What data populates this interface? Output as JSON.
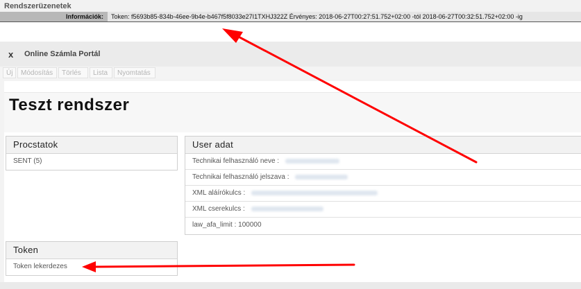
{
  "system_messages": {
    "title": "Rendszerüzenetek",
    "info_label": "Információk:",
    "info_text": "Token: f5693b85-834b-46ee-9b4e-b467f5f8033e27I1TXHJ322Z Érvényes: 2018-06-27T00:27:51.752+02:00 -tól 2018-06-27T00:32:51.752+02:00 -ig"
  },
  "portal": {
    "close_label": "x",
    "title": "Online Számla Portál"
  },
  "toolbar": {
    "items": [
      "Új",
      "Módosítás",
      "Törlés",
      "Lista",
      "Nyomtatás"
    ]
  },
  "main": {
    "heading": "Teszt rendszer"
  },
  "procstatok": {
    "title": "Procstatok",
    "items": [
      "SENT (5)"
    ]
  },
  "token": {
    "title": "Token",
    "items": [
      "Token lekerdezes"
    ]
  },
  "user_adat": {
    "title": "User adat",
    "fields": [
      {
        "label": "Technikai felhasználó neve :"
      },
      {
        "label": "Technikai felhasználó jelszava :"
      },
      {
        "label": "XML aláírókulcs :"
      },
      {
        "label": "XML cserekulcs :"
      },
      {
        "label": "law_afa_limit : 100000"
      }
    ]
  },
  "colors": {
    "annotation_arrow": "#ff0000"
  }
}
